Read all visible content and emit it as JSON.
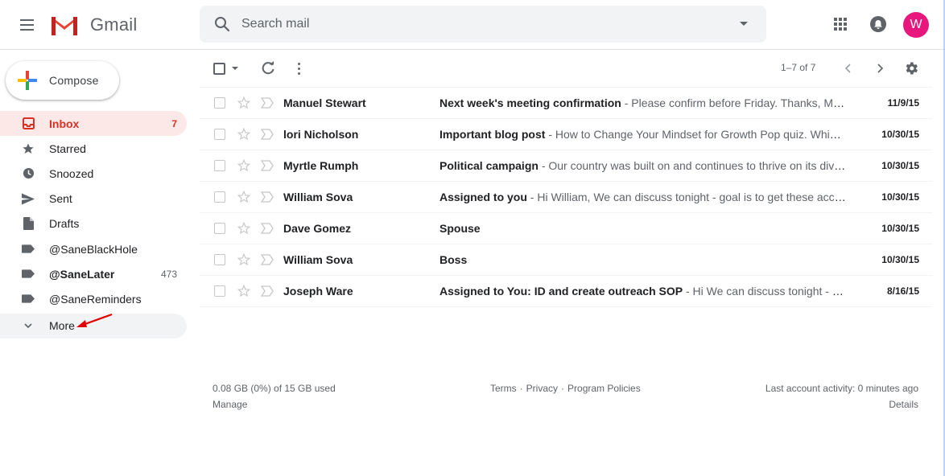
{
  "app": {
    "logo_text": "Gmail",
    "avatar_letter": "W",
    "avatar_color": "#e8177d",
    "icons": [
      "menu-icon",
      "gmail-logo-icon",
      "search-icon",
      "dropdown-caret-icon",
      "apps-grid-icon",
      "notifications-icon"
    ]
  },
  "search": {
    "placeholder": "Search mail"
  },
  "compose": {
    "label": "Compose"
  },
  "sidebar": {
    "items": [
      {
        "label": "Inbox",
        "count": "7",
        "icon": "inbox-icon"
      },
      {
        "label": "Starred",
        "count": "",
        "icon": "star-icon"
      },
      {
        "label": "Snoozed",
        "count": "",
        "icon": "clock-icon"
      },
      {
        "label": "Sent",
        "count": "",
        "icon": "send-icon"
      },
      {
        "label": "Drafts",
        "count": "",
        "icon": "draft-icon"
      },
      {
        "label": "@SaneBlackHole",
        "count": "",
        "icon": "label-icon"
      },
      {
        "label": "@SaneLater",
        "count": "473",
        "icon": "label-icon"
      },
      {
        "label": "@SaneReminders",
        "count": "",
        "icon": "label-icon"
      },
      {
        "label": "More",
        "count": "",
        "icon": "chevron-down-icon"
      }
    ]
  },
  "toolbar": {
    "range": "1–7 of 7"
  },
  "emails": [
    {
      "sender": "Manuel Stewart",
      "subject": "Next week's meeting confirmation",
      "snippet": " - Please confirm before Friday. Thanks, Man...",
      "date": "11/9/15"
    },
    {
      "sender": "lori Nicholson",
      "subject": "Important blog post",
      "snippet": " - How to Change Your Mindset for Growth Pop quiz. Which...",
      "date": "10/30/15"
    },
    {
      "sender": "Myrtle Rumph",
      "subject": "Political campaign",
      "snippet": " - Our country was built on and continues to thrive on its dive...",
      "date": "10/30/15"
    },
    {
      "sender": "William Sova",
      "subject": "Assigned to you",
      "snippet": " - Hi William, We can discuss tonight - goal is to get these acco...",
      "date": "10/30/15"
    },
    {
      "sender": "Dave Gomez",
      "subject": "Spouse",
      "snippet": "",
      "date": "10/30/15"
    },
    {
      "sender": "William Sova",
      "subject": "Boss",
      "snippet": "",
      "date": "10/30/15"
    },
    {
      "sender": "Joseph Ware",
      "subject": "Assigned to You: ID and create outreach SOP",
      "snippet": " - Hi We can discuss tonight - goa...",
      "date": "8/16/15"
    }
  ],
  "footer": {
    "storage": "0.08 GB (0%) of 15 GB used",
    "manage": "Manage",
    "terms": "Terms",
    "sep": "·",
    "privacy": "Privacy",
    "policies": "Program Policies",
    "activity": "Last account activity: 0 minutes ago",
    "details": "Details"
  },
  "colors": {
    "accent_red": "#d93025",
    "active_bg": "#fce8e6",
    "annotation_arrow": "#e00000"
  }
}
